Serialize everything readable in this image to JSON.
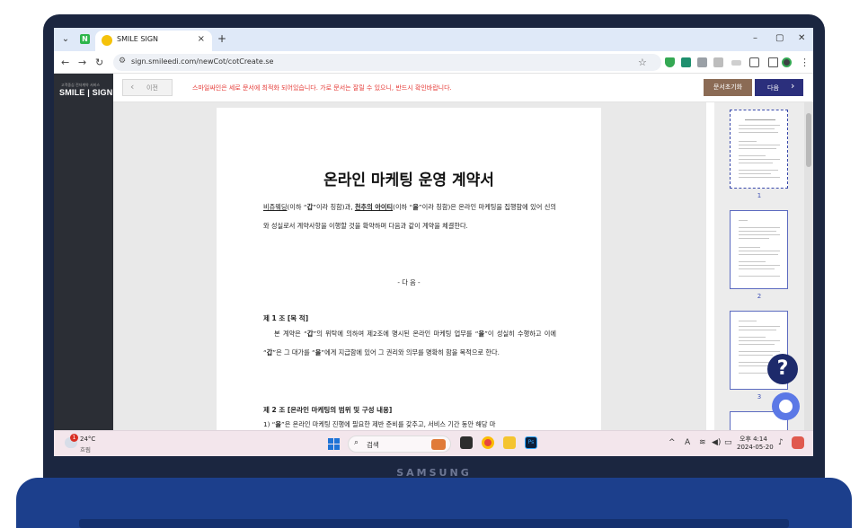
{
  "browser": {
    "tab_title": "SMILE SIGN",
    "tab_close": "×",
    "new_tab": "+",
    "url": "sign.smileedi.com/newCot/cotCreate.se",
    "min": "–",
    "max": "▢",
    "close": "✕"
  },
  "app": {
    "logo_small": "고객중심 전자계약 서비스",
    "logo_main": "SMILE | SIGN",
    "prev_label": "이전",
    "notice": "스마일싸인은 세로 문서에 최적화 되어있습니다. 가로 문서는 잘릴 수 있으니, 반드시 확인바랍니다.",
    "reset_label": "문서초기화",
    "next_label": "다음"
  },
  "document": {
    "title": "온라인 마케팅 운영 계약서",
    "intro_party1": "비쥬웨딩",
    "intro_mid1": "(이하 “",
    "gap": "갑",
    "intro_mid2": "”이라 칭함)과, ",
    "intro_party2": "천추의 아이티",
    "intro_mid3": "(이하 “",
    "eul": "을",
    "intro_rest": "”이라 칭함)은 온라인 마케팅을 집행함에 있어 신의와 성실로서 계약사항을 이행할 것을 확약하며 다음과 같이 계약을 체결한다.",
    "dahum": "- 다     음 -",
    "art1_title": "제 1 조 [목 적]",
    "art1_a": "본 계약은 “",
    "art1_b": "”의 위탁에 의하여 제2조에 명시된 온라인 마케팅 업무를 “",
    "art1_c": "”이 성실히 수행하고 이에 “",
    "art1_d": "”은 그 대가를 “",
    "art1_e": "”에게 지급함에 있어 그 권리와 의무를 명확히 함을 목적으로 한다.",
    "art2_title": "제 2 조 [온라인 마케팅의 범위 및 구성 내용]",
    "art2_a": "1) “",
    "art2_b": "”은 온라인 마케팅 진행에 필요한 제반 준비를 갖추고, 서비스 기간 동안 해당 마"
  },
  "thumbnails": [
    "1",
    "2",
    "3"
  ],
  "help_label": "?",
  "taskbar": {
    "weather_badge": "1",
    "temperature": "24°C",
    "weather_desc": "흐림",
    "search_label": "검색",
    "lang": "A",
    "time": "오후 4:14",
    "date": "2024-05-20"
  },
  "laptop_brand": "SAMSUNG"
}
